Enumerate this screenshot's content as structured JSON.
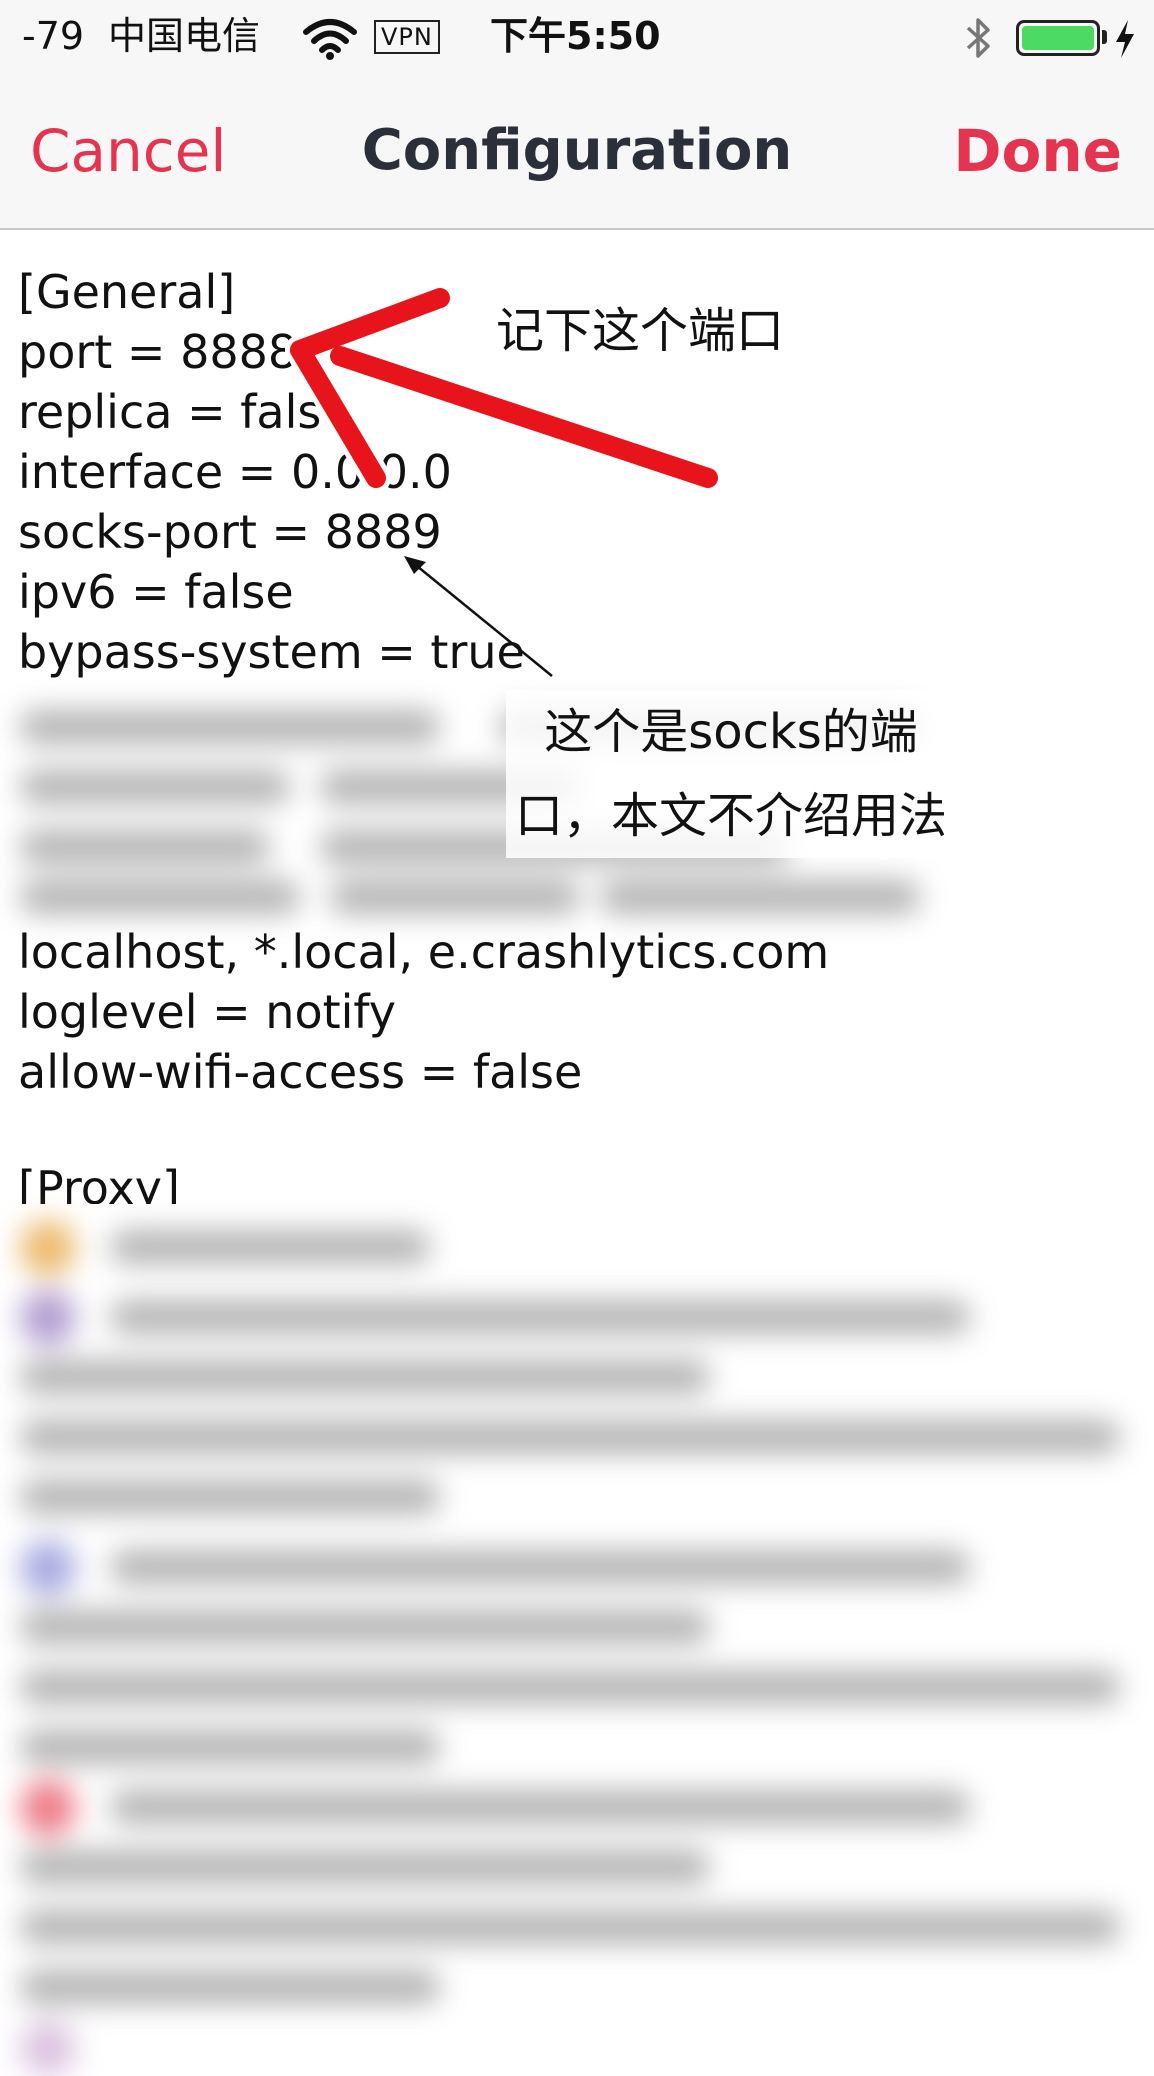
{
  "status_bar": {
    "signal": "-79",
    "carrier": "中国电信",
    "wifi_icon": "wifi-icon",
    "vpn": "VPN",
    "time": "下午5:50",
    "bluetooth_icon": "bluetooth-icon",
    "battery_icon": "battery-icon",
    "charging_icon": "charging-bolt-icon",
    "battery_color": "#4cd964"
  },
  "nav": {
    "cancel_label": "Cancel",
    "title": "Configuration",
    "done_label": "Done",
    "accent_color": "#e5344f"
  },
  "config": {
    "lines_top": [
      "[General]",
      "port = 8888",
      "replica = false",
      "interface = 0.0.0.0",
      "socks-port = 8889",
      "ipv6 = false",
      "bypass-system = true"
    ],
    "lines_middle": [
      "localhost, *.local, e.crashlytics.com",
      "loglevel = notify",
      "allow-wifi-access = false"
    ],
    "proxy_header": "[Proxy]"
  },
  "annotations": {
    "port_note": "记下这个端口",
    "socks_note": "这个是socks的端口，本文不介绍用法",
    "arrow_color": "#e8141c"
  }
}
